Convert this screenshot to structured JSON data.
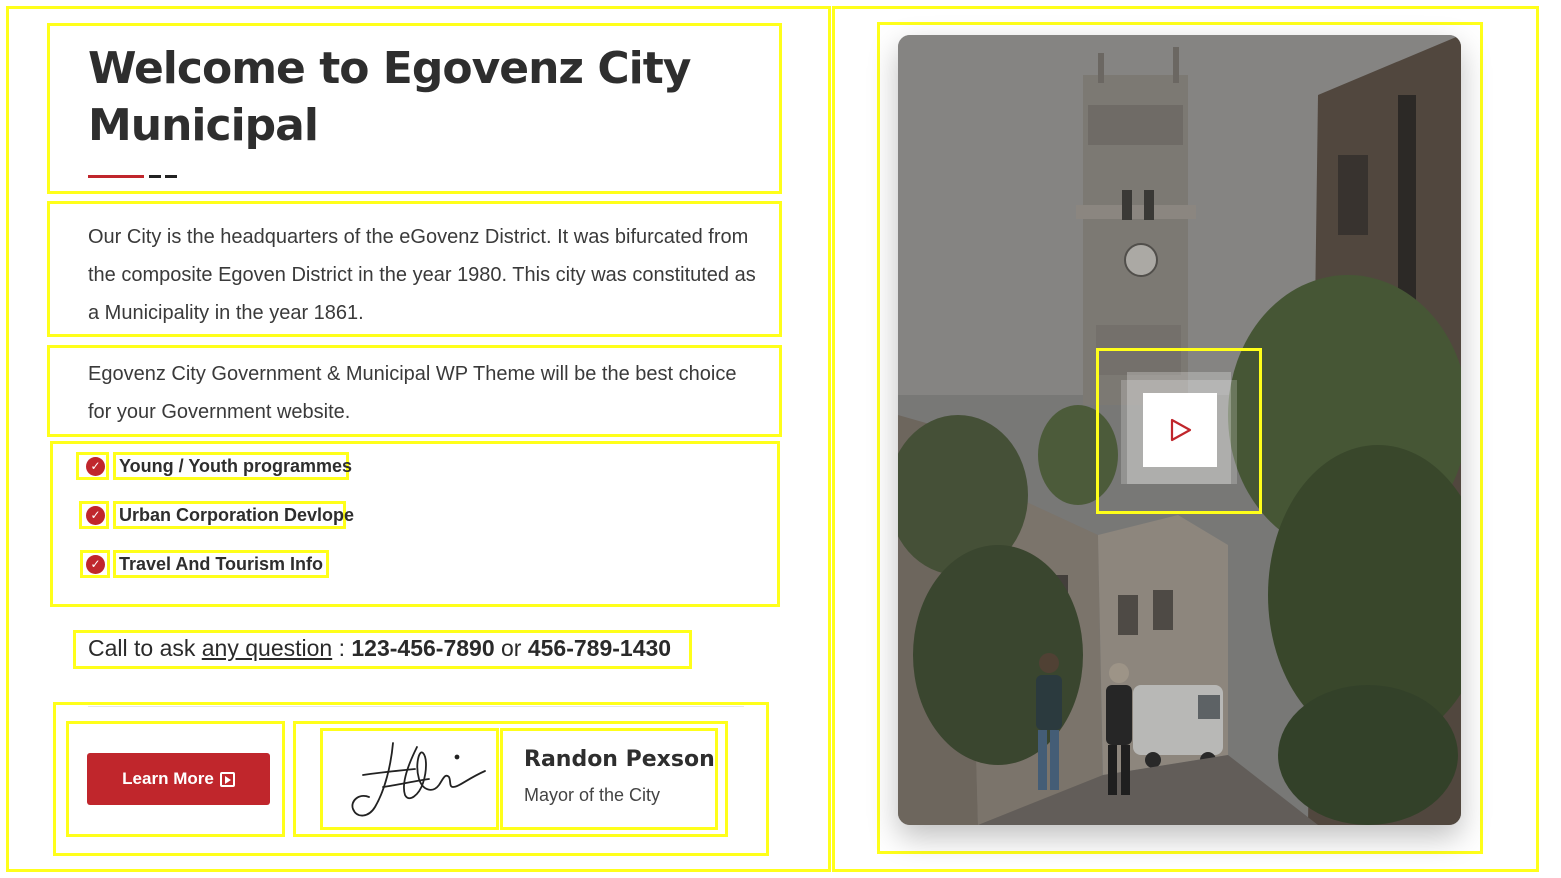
{
  "heading": {
    "title": "Welcome to Egovenz City Municipal"
  },
  "intro": {
    "paragraph1": "Our City is the headquarters of the eGovenz District. It was bifurcated from the composite Egoven District in the year 1980. This city was constituted as a Municipality in the year 1861.",
    "paragraph2": "Egovenz City Government & Municipal WP Theme will be the best choice for your Government website."
  },
  "features": [
    {
      "label": "Young / Youth programmes",
      "icon": "check-circle-icon"
    },
    {
      "label": "Urban Corporation Devlope",
      "icon": "check-circle-icon"
    },
    {
      "label": "Travel And Tourism Info",
      "icon": "check-circle-icon"
    }
  ],
  "call": {
    "prefix": "Call to ask ",
    "link_text": "any question",
    "separator": " : ",
    "phone1": "123-456-7890",
    "or": " or ",
    "phone2": "456-789-1430"
  },
  "cta": {
    "label": "Learn More",
    "icon": "external-arrow-icon"
  },
  "mayor": {
    "name": "Randon Pexson",
    "title": "Mayor of the City"
  },
  "video": {
    "icon": "play-icon"
  },
  "colors": {
    "accent": "#c0262c",
    "heading": "#2e2e2e",
    "annotation_box": "#ffff1a"
  }
}
